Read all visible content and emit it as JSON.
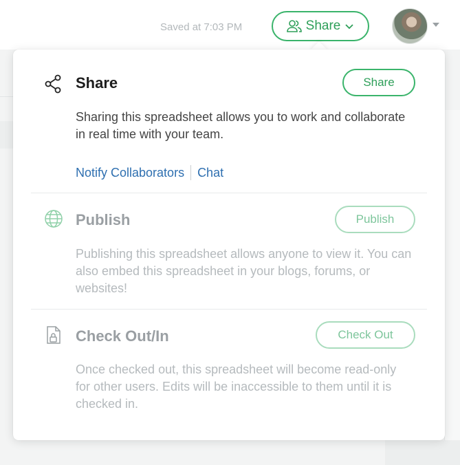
{
  "header": {
    "saved_status": "Saved at 7:03 PM",
    "share_button_label": "Share",
    "avatar_icon": "user-avatar"
  },
  "popover": {
    "share": {
      "icon": "share-nodes-icon",
      "title": "Share",
      "button_label": "Share",
      "description": "Sharing this spreadsheet allows you to work and collaborate in real time with your team.",
      "links": [
        "Notify Collaborators",
        "Chat"
      ]
    },
    "publish": {
      "icon": "globe-icon",
      "title": "Publish",
      "button_label": "Publish",
      "description": "Publishing this spreadsheet allows anyone to view it. You can also embed this spreadsheet in your blogs, forums, or websites!"
    },
    "checkout": {
      "icon": "document-lock-icon",
      "title": "Check Out/In",
      "button_label": "Check Out",
      "description": "Once checked out, this spreadsheet will become read-only for other users. Edits will be inaccessible to them until it is checked in."
    }
  },
  "colors": {
    "accent_green": "#2e9f59",
    "muted_green": "#7dc59b",
    "link_blue": "#2e6fb0"
  }
}
